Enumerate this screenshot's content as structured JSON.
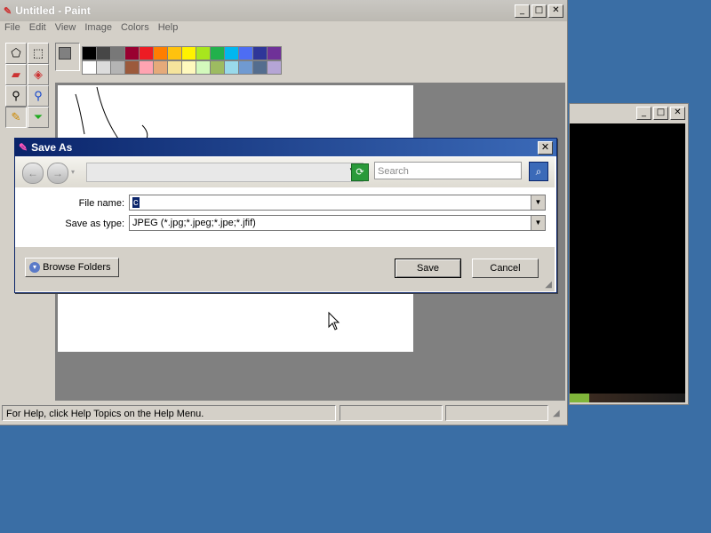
{
  "paint": {
    "title": "Untitled - Paint",
    "menu": [
      "File",
      "Edit",
      "View",
      "Image",
      "Colors",
      "Help"
    ],
    "status_text": "For Help, click Help Topics on the Help Menu.",
    "palette_top": [
      "#000000",
      "#464646",
      "#787878",
      "#990030",
      "#ed1c24",
      "#ff7e00",
      "#ffc20e",
      "#fff200",
      "#a8e61d",
      "#22b14c",
      "#00b7ef",
      "#4d6df3",
      "#2f3699",
      "#6f3198"
    ],
    "palette_bottom": [
      "#ffffff",
      "#dcdcdc",
      "#b4b4b4",
      "#9c5a3c",
      "#ffa3b1",
      "#e5aa7a",
      "#f5e49c",
      "#fff9bd",
      "#d3f9bc",
      "#9dbb61",
      "#99d9ea",
      "#709ad1",
      "#546d8e",
      "#b5a5d5"
    ]
  },
  "dialog": {
    "title": "Save As",
    "search_placeholder": "Search",
    "file_name_label": "File name:",
    "file_name_value": "c",
    "save_type_label": "Save as type:",
    "save_type_value": "JPEG (*.jpg;*.jpeg;*.jpe;*.jfif)",
    "browse_label": "Browse Folders",
    "save_label": "Save",
    "cancel_label": "Cancel"
  },
  "icons": {
    "close": "✕",
    "minimize": "_",
    "maximize": "□",
    "back": "←",
    "forward": "→",
    "dropdown": "▼",
    "refresh": "⟳",
    "search": "⌕",
    "expand": "▾"
  }
}
